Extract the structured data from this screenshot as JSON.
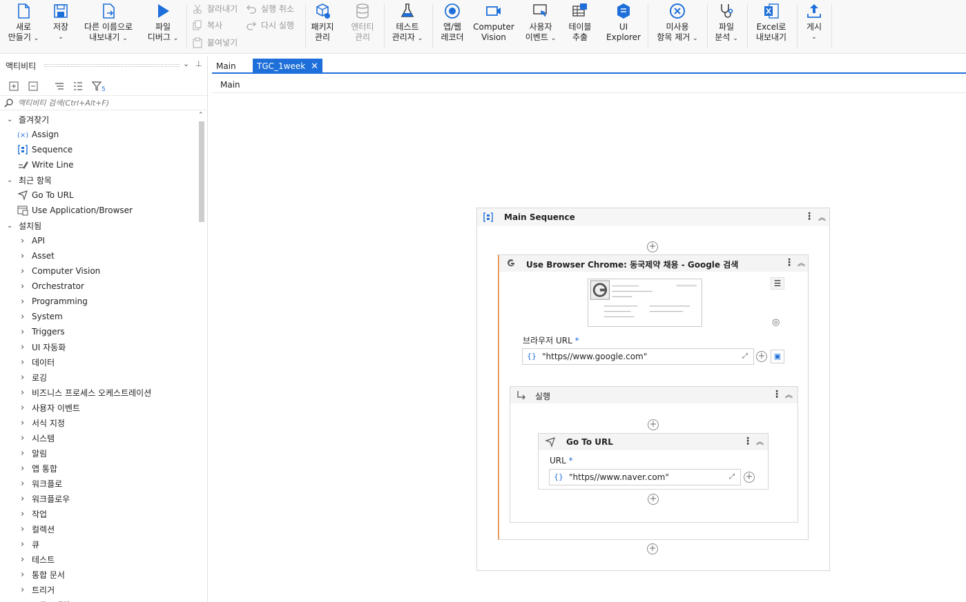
{
  "toolbar": {
    "new": {
      "l1": "새로",
      "l2": "만들기"
    },
    "save": {
      "l1": "저장",
      "l2": ""
    },
    "save_as": {
      "l1": "다른 이름으로",
      "l2": "내보내기"
    },
    "debug": {
      "l1": "파일",
      "l2": "디버그"
    },
    "cut": "잘라내기",
    "copy": "복사",
    "paste": "붙여넣기",
    "undo": "실행 취소",
    "redo": "다시 실행",
    "packages": {
      "l1": "패키지",
      "l2": "관리"
    },
    "entities": {
      "l1": "엔터티",
      "l2": "관리"
    },
    "test_manager": {
      "l1": "테스트",
      "l2": "관리자"
    },
    "recorder": {
      "l1": "앱/웹",
      "l2": "레코더"
    },
    "cv": {
      "l1": "Computer",
      "l2": "Vision"
    },
    "user_events": {
      "l1": "사용자",
      "l2": "이벤트"
    },
    "table_extract": {
      "l1": "테이블",
      "l2": "추출"
    },
    "ui_explorer": {
      "l1": "UI",
      "l2": "Explorer"
    },
    "remove_unused": {
      "l1": "미사용",
      "l2": "항목 제거"
    },
    "file_analyze": {
      "l1": "파일",
      "l2": "분석"
    },
    "excel_export": {
      "l1": "Excel로",
      "l2": "내보내기"
    },
    "publish": {
      "l1": "게시",
      "l2": ""
    }
  },
  "panel": {
    "title": "액티비티",
    "search_placeholder": "액티비티 검색(Ctrl+Alt+F)",
    "filter_count": "5",
    "tree": [
      {
        "label": "즐겨찾기",
        "kind": "group",
        "open": true
      },
      {
        "label": "Assign",
        "kind": "activity",
        "icon": "assign-icon"
      },
      {
        "label": "Sequence",
        "kind": "activity",
        "icon": "sequence-icon"
      },
      {
        "label": "Write Line",
        "kind": "activity",
        "icon": "write-line-icon"
      },
      {
        "label": "최근 항목",
        "kind": "group",
        "open": true
      },
      {
        "label": "Go To URL",
        "kind": "activity",
        "icon": "go-to-url-icon"
      },
      {
        "label": "Use Application/Browser",
        "kind": "activity",
        "icon": "use-browser-icon"
      },
      {
        "label": "설치됨",
        "kind": "group",
        "open": true
      },
      {
        "label": "API",
        "kind": "sub"
      },
      {
        "label": "Asset",
        "kind": "sub"
      },
      {
        "label": "Computer Vision",
        "kind": "sub"
      },
      {
        "label": "Orchestrator",
        "kind": "sub"
      },
      {
        "label": "Programming",
        "kind": "sub"
      },
      {
        "label": "System",
        "kind": "sub"
      },
      {
        "label": "Triggers",
        "kind": "sub"
      },
      {
        "label": "UI 자동화",
        "kind": "sub"
      },
      {
        "label": "데이터",
        "kind": "sub"
      },
      {
        "label": "로깅",
        "kind": "sub"
      },
      {
        "label": "비즈니스 프로세스 오케스트레이션",
        "kind": "sub"
      },
      {
        "label": "사용자 이벤트",
        "kind": "sub"
      },
      {
        "label": "서식 지정",
        "kind": "sub"
      },
      {
        "label": "시스템",
        "kind": "sub"
      },
      {
        "label": "알림",
        "kind": "sub"
      },
      {
        "label": "앱 통합",
        "kind": "sub"
      },
      {
        "label": "워크플로",
        "kind": "sub"
      },
      {
        "label": "워크플로우",
        "kind": "sub"
      },
      {
        "label": "작업",
        "kind": "sub"
      },
      {
        "label": "컬렉션",
        "kind": "sub"
      },
      {
        "label": "큐",
        "kind": "sub"
      },
      {
        "label": "테스트",
        "kind": "sub"
      },
      {
        "label": "통합 문서",
        "kind": "sub"
      },
      {
        "label": "트리거",
        "kind": "sub"
      },
      {
        "label": "프로그래밍",
        "kind": "sub"
      }
    ]
  },
  "designer": {
    "tabs": [
      {
        "label": "Main",
        "active": false
      },
      {
        "label": "TGC_1week",
        "active": true
      }
    ],
    "breadcrumb": "Main",
    "main_sequence": {
      "title": "Main Sequence"
    },
    "browser": {
      "title": "Use Browser Chrome: 동국제약 채용 - Google 검색",
      "url_label": "브라우저 URL",
      "url_value": "\"https//www.google.com\""
    },
    "do": {
      "title": "실행"
    },
    "goto": {
      "title": "Go To URL",
      "url_label": "URL",
      "url_value": "\"https//www.naver.com\""
    },
    "required_mark": "*",
    "brace": "{}"
  },
  "colors": {
    "accent": "#1e6fd9",
    "border": "#d6d6d6",
    "header_bg": "#f4f4f4"
  }
}
